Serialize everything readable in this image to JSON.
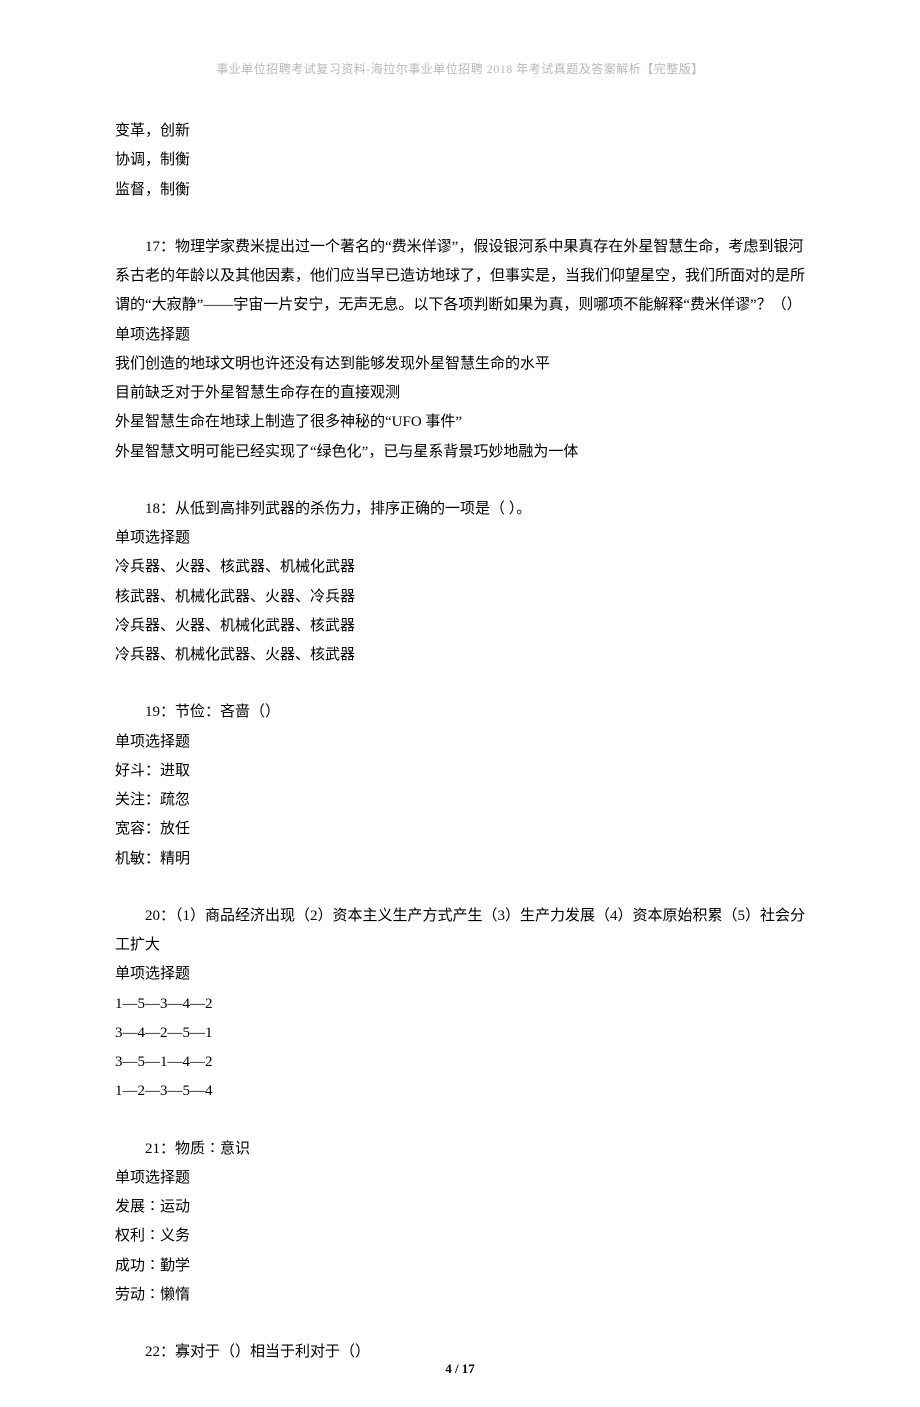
{
  "header": "事业单位招聘考试复习资料-海拉尔事业单位招聘 2018 年考试真题及答案解析【完整版】",
  "footer": "4 / 17",
  "blocks": [
    {
      "lines": [
        {
          "text": "变革，创新",
          "indent": false
        },
        {
          "text": "协调，制衡",
          "indent": false
        },
        {
          "text": "监督，制衡",
          "indent": false
        }
      ]
    },
    {
      "lines": [
        {
          "text": "17：物理学家费米提出过一个著名的“费米佯谬”，假设银河系中果真存在外星智慧生命，考虑到银河系古老的年龄以及其他因素，他们应当早已造访地球了，但事实是，当我们仰望星空，我们所面对的是所谓的“大寂静”——宇宙一片安宁，无声无息。以下各项判断如果为真，则哪项不能解释“费米佯谬”？（）",
          "indent": true
        },
        {
          "text": "单项选择题",
          "indent": false
        },
        {
          "text": "我们创造的地球文明也许还没有达到能够发现外星智慧生命的水平",
          "indent": false
        },
        {
          "text": "目前缺乏对于外星智慧生命存在的直接观测",
          "indent": false
        },
        {
          "text": "外星智慧生命在地球上制造了很多神秘的“UFO 事件”",
          "indent": false
        },
        {
          "text": "外星智慧文明可能已经实现了“绿色化”，已与星系背景巧妙地融为一体",
          "indent": false
        }
      ]
    },
    {
      "lines": [
        {
          "text": "18：从低到高排列武器的杀伤力，排序正确的一项是（  ）。",
          "indent": true
        },
        {
          "text": "单项选择题",
          "indent": false
        },
        {
          "text": "冷兵器、火器、核武器、机械化武器",
          "indent": false
        },
        {
          "text": "核武器、机械化武器、火器、冷兵器",
          "indent": false
        },
        {
          "text": "冷兵器、火器、机械化武器、核武器",
          "indent": false
        },
        {
          "text": "冷兵器、机械化武器、火器、核武器",
          "indent": false
        }
      ]
    },
    {
      "lines": [
        {
          "text": "19：节俭：吝啬（）",
          "indent": true
        },
        {
          "text": "单项选择题",
          "indent": false
        },
        {
          "text": "好斗：进取",
          "indent": false
        },
        {
          "text": "关注：疏忽",
          "indent": false
        },
        {
          "text": "宽容：放任",
          "indent": false
        },
        {
          "text": "机敏：精明",
          "indent": false
        }
      ]
    },
    {
      "lines": [
        {
          "text": "20：（1）商品经济出现（2）资本主义生产方式产生（3）生产力发展（4）资本原始积累（5）社会分工扩大",
          "indent": true
        },
        {
          "text": "单项选择题",
          "indent": false
        },
        {
          "text": "1—5—3—4—2",
          "indent": false
        },
        {
          "text": "3—4—2—5—1",
          "indent": false
        },
        {
          "text": "3—5—1—4—2",
          "indent": false
        },
        {
          "text": "1—2—3—5—4",
          "indent": false
        }
      ]
    },
    {
      "lines": [
        {
          "text": "21：物质∶意识",
          "indent": true
        },
        {
          "text": "单项选择题",
          "indent": false
        },
        {
          "text": "发展∶运动",
          "indent": false
        },
        {
          "text": "权利∶义务",
          "indent": false
        },
        {
          "text": "成功∶勤学",
          "indent": false
        },
        {
          "text": "劳动∶懒惰",
          "indent": false
        }
      ]
    },
    {
      "lines": [
        {
          "text": "22：寡对于（）相当于利对于（）",
          "indent": true
        }
      ]
    }
  ]
}
